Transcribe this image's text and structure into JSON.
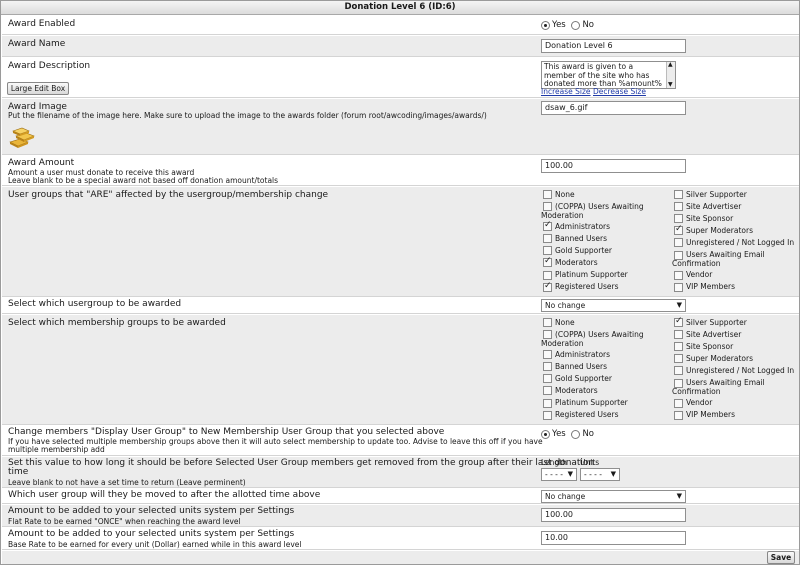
{
  "title": "Donation Level 6 (ID:6)",
  "enabled": {
    "label": "Award Enabled",
    "yes": "Yes",
    "no": "No"
  },
  "name": {
    "label": "Award Name",
    "value": "Donation Level 6"
  },
  "description": {
    "label": "Award Description",
    "button": "Large Edit Box",
    "value": "This award is given to a member of the site who has donated more than %amount% %currency%",
    "increase": "Increase Size",
    "decrease": "Decrease Size"
  },
  "image": {
    "label": "Award Image",
    "help": "Put the filename of the image here. Make sure to upload the image to the awards folder (forum root/awcoding/images/awards/)",
    "value": "dsaw_6.gif"
  },
  "amount": {
    "label": "Award Amount",
    "help1": "Amount a user must donate to receive this award",
    "help2": "Leave blank to be a special award not based off donation amount/totals",
    "value": "100.00"
  },
  "affected": {
    "label": "User groups that \"ARE\" affected by the usergroup/membership change",
    "col1": [
      {
        "name": "None",
        "checked": false
      },
      {
        "name": "(COPPA) Users Awaiting",
        "name2": "Moderation",
        "checked": false
      },
      {
        "name": "Administrators",
        "checked": true
      },
      {
        "name": "Banned Users",
        "checked": false
      },
      {
        "name": "Gold Supporter",
        "checked": false
      },
      {
        "name": "Moderators",
        "checked": true
      },
      {
        "name": "Platinum Supporter",
        "checked": false
      },
      {
        "name": "Registered Users",
        "checked": true
      }
    ],
    "col2": [
      {
        "name": "Silver Supporter",
        "checked": false
      },
      {
        "name": "Site Advertiser",
        "checked": false
      },
      {
        "name": "Site Sponsor",
        "checked": false
      },
      {
        "name": "Super Moderators",
        "checked": true
      },
      {
        "name": "Unregistered / Not Logged In",
        "checked": false
      },
      {
        "name": "Users Awaiting Email",
        "name2": "Confirmation",
        "checked": false
      },
      {
        "name": "Vendor",
        "checked": false
      },
      {
        "name": "VIP Members",
        "checked": false
      }
    ]
  },
  "usergroup_award": {
    "label": "Select which usergroup to be awarded",
    "value": "No change"
  },
  "membership": {
    "label": "Select which membership groups to be awarded",
    "col1": [
      {
        "name": "None",
        "checked": false
      },
      {
        "name": "(COPPA) Users Awaiting",
        "name2": "Moderation",
        "checked": false
      },
      {
        "name": "Administrators",
        "checked": false
      },
      {
        "name": "Banned Users",
        "checked": false
      },
      {
        "name": "Gold Supporter",
        "checked": false
      },
      {
        "name": "Moderators",
        "checked": false
      },
      {
        "name": "Platinum Supporter",
        "checked": false
      },
      {
        "name": "Registered Users",
        "checked": false
      }
    ],
    "col2": [
      {
        "name": "Silver Supporter",
        "checked": true
      },
      {
        "name": "Site Advertiser",
        "checked": false
      },
      {
        "name": "Site Sponsor",
        "checked": false
      },
      {
        "name": "Super Moderators",
        "checked": false
      },
      {
        "name": "Unregistered / Not Logged In",
        "checked": false
      },
      {
        "name": "Users Awaiting Email",
        "name2": "Confirmation",
        "checked": false
      },
      {
        "name": "Vendor",
        "checked": false
      },
      {
        "name": "VIP Members",
        "checked": false
      }
    ]
  },
  "display_group": {
    "label": "Change members \"Display User Group\" to New Membership User Group that you selected above",
    "help1": "If you have selected multiple membership groups above then it will auto select membership to update too. Advise to leave this off if you have",
    "help2": "multiple membership add",
    "yes": "Yes",
    "no": "No"
  },
  "removal": {
    "label1": "Set this value to how long it should be before Selected User Group members get removed from the group after their last donation",
    "label2": "time",
    "help": "Leave blank to not have a set time to return (Leave perminent)",
    "length_label": "Length",
    "units_label": "Units",
    "length_value": "- - - -",
    "units_value": "- - - -"
  },
  "moved_to": {
    "label": "Which user group will they be moved to after the allotted time above",
    "value": "No change"
  },
  "flat_rate": {
    "label": "Amount to be added to your selected units system per Settings",
    "help": "Flat Rate to be earned \"ONCE\" when reaching the award level",
    "value": "100.00"
  },
  "base_rate": {
    "label": "Amount to be added to your selected units system per Settings",
    "help": "Base Rate to be earned for every unit (Dollar) earned while in this award level",
    "value": "10.00"
  },
  "save": "Save"
}
